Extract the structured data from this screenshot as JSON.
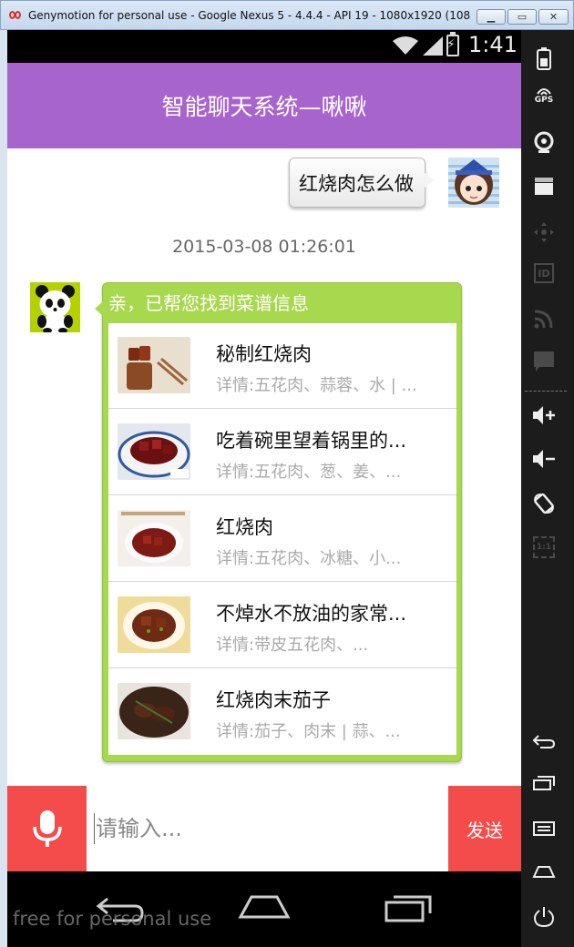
{
  "window": {
    "title": "Genymotion for personal use - Google Nexus 5 - 4.4.4 - API 19 - 1080x1920 (1080...",
    "minimize": "minimize",
    "maximize": "maximize",
    "close": "close"
  },
  "statusbar": {
    "time": "1:41"
  },
  "appbar": {
    "title": "智能聊天系统—啾啾"
  },
  "chat": {
    "sent_message": "红烧肉怎么做",
    "timestamp": "2015-03-08 01:26:01",
    "reply_header": "亲，已帮您找到菜谱信息",
    "recipes": [
      {
        "title": "秘制红烧肉",
        "detail": "详情:五花肉、蒜蓉、水 | ..."
      },
      {
        "title": "吃着碗里望着锅里的...",
        "detail": "详情:五花肉、葱、姜、..."
      },
      {
        "title": "红烧肉",
        "detail": "详情:五花肉、冰糖、小..."
      },
      {
        "title": "不焯水不放油的家常...",
        "detail": "详情:带皮五花肉、..."
      },
      {
        "title": "红烧肉末茄子",
        "detail": "详情:茄子、肉末 | 蒜、..."
      }
    ]
  },
  "input": {
    "placeholder": "请输入...",
    "value": "",
    "send_label": "发送"
  },
  "watermark": "free for personal use",
  "sidepanel": {
    "gps_label": "GPS",
    "id_label": "ID",
    "scale_label": "1:1"
  },
  "colors": {
    "appbar": "#a864cd",
    "reply_bubble": "#a8d84e",
    "action_red": "#f44b4b"
  }
}
